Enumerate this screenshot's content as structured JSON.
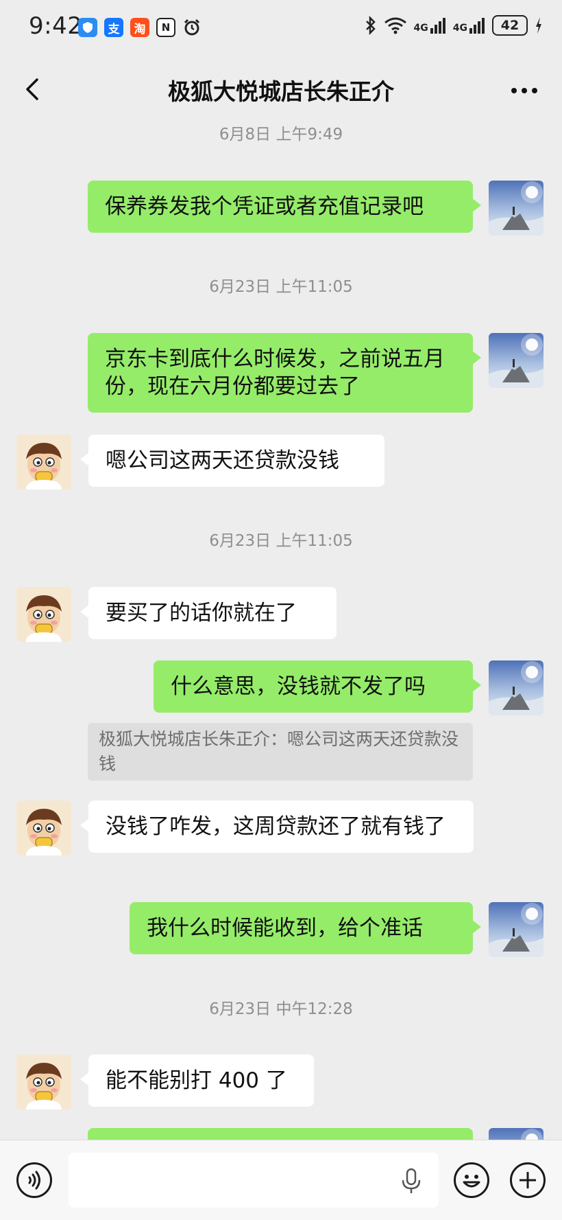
{
  "status_bar": {
    "time": "9:42",
    "app_icons": [
      "支",
      "淘",
      "N"
    ],
    "network": [
      "4G",
      "4G"
    ],
    "battery": "42"
  },
  "header": {
    "title": "极狐大悦城店长朱正介"
  },
  "messages": {
    "ts1": "6月8日 上午9:49",
    "m1": "保养券发我个凭证或者充值记录吧",
    "ts2": "6月23日 上午11:05",
    "m2": "京东卡到底什么时候发，之前说五月份，现在六月份都要过去了",
    "m3": "嗯公司这两天还贷款没钱",
    "ts3": "6月23日 上午11:05",
    "m4": "要买了的话你就在了",
    "m5": "什么意思，没钱就不发了吗",
    "quote5": "极狐大悦城店长朱正介：嗯公司这两天还贷款没钱",
    "m6": "没钱了咋发，这周贷款还了就有钱了",
    "m7": "我什么时候能收到，给个准话",
    "ts4": "6月23日 中午12:28",
    "m8": "能不能别打 400 了"
  },
  "input": {
    "placeholder": ""
  },
  "colors": {
    "background": "#ededed",
    "outgoing_bubble": "#95ec69",
    "incoming_bubble": "#ffffff",
    "quote_bg": "#dedede"
  }
}
